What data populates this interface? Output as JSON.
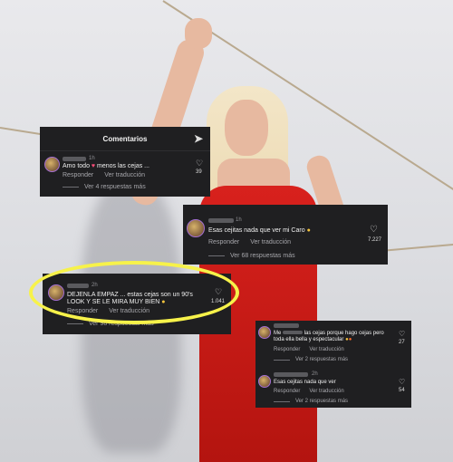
{
  "panel_top": {
    "title": "Comentarios",
    "comment": {
      "time": "1h",
      "text_pre": "Amo todo",
      "text_post": "menos las cejas ...",
      "reply": "Responder",
      "translate": "Ver traducción",
      "likes": "39",
      "more": "Ver 4 respuestas más"
    }
  },
  "panel_mid": {
    "time": "1h",
    "text": "Esas cejitas nada que ver mi Caro",
    "reply": "Responder",
    "translate": "Ver traducción",
    "likes": "7.227",
    "more": "Ver 68 respuestas más"
  },
  "panel_hl": {
    "time": "2h",
    "text": "DEJENLA EMPAZ ... estas cejas son un 90's LOOK Y SE LE MIRA MUY BIEN",
    "reply": "Responder",
    "translate": "Ver traducción",
    "likes": "1.041",
    "more": "Ver 98 respuestas más"
  },
  "panel_br": {
    "c1": {
      "prefix": "Me",
      "text": "las cejas porque hago cejas pero toda ella bella y espectacular",
      "reply": "Responder",
      "translate": "Ver traducción",
      "likes": "27",
      "more": "Ver 2 respuestas más"
    },
    "c2": {
      "time": "2h",
      "text": "Esas cejitas nada que ver",
      "reply": "Responder",
      "translate": "Ver traducción",
      "likes": "54",
      "more": "Ver 2 respuestas más"
    }
  },
  "colors": {
    "accent_highlight": "#f7f24a",
    "dress": "#d8211d",
    "panel_bg": "#1f1f21"
  }
}
